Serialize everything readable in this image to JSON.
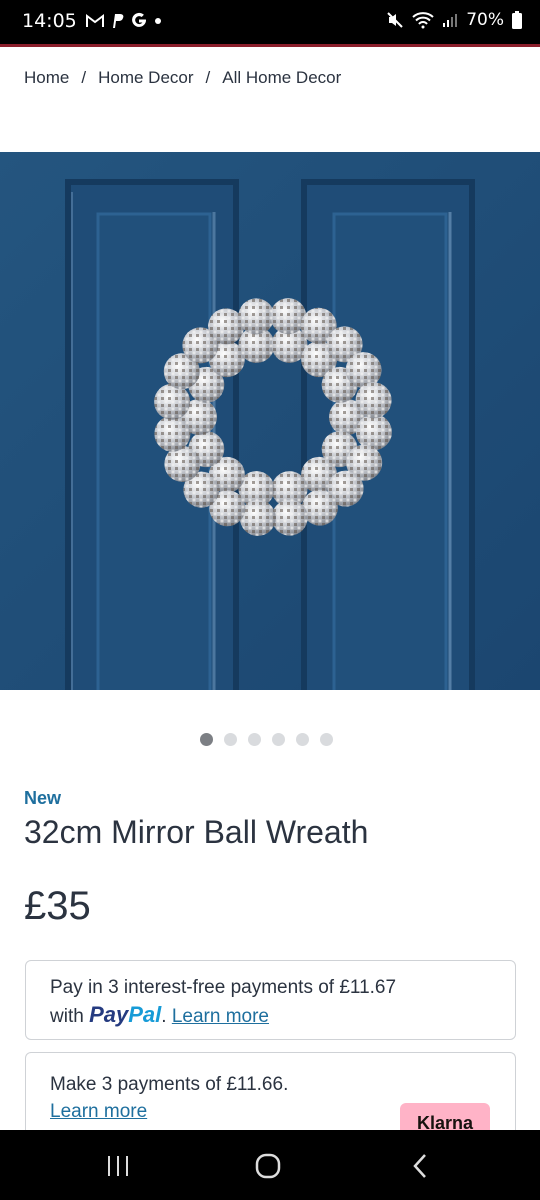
{
  "status_bar": {
    "time": "14:05",
    "battery": "70%",
    "notification_icons": [
      "gmail-icon",
      "paypal-icon",
      "google-icon",
      "dot-icon"
    ],
    "right_icons": [
      "mute-icon",
      "wifi-icon",
      "signal-icon",
      "battery-icon"
    ]
  },
  "breadcrumb": {
    "items": [
      "Home",
      "Home Decor",
      "All Home Decor"
    ],
    "separator": "/"
  },
  "carousel": {
    "total": 6,
    "active_index": 0
  },
  "product": {
    "badge": "New",
    "title": "32cm Mirror Ball Wreath",
    "price": "£35"
  },
  "paypal": {
    "line1": "Pay in 3 interest-free payments of £11.67",
    "with": "with",
    "logo_pay": "Pay",
    "logo_pal": "Pal",
    "period": ".",
    "learn_more": "Learn more"
  },
  "klarna": {
    "line1": "Make 3 payments of £11.66.",
    "learn_more": "Learn more",
    "badge": "Klarna"
  },
  "colors": {
    "door": "#1f4e7a",
    "accent_link": "#1e6f9e",
    "status_accent": "#8b1e2b",
    "klarna_pink": "#ffb3c7"
  }
}
